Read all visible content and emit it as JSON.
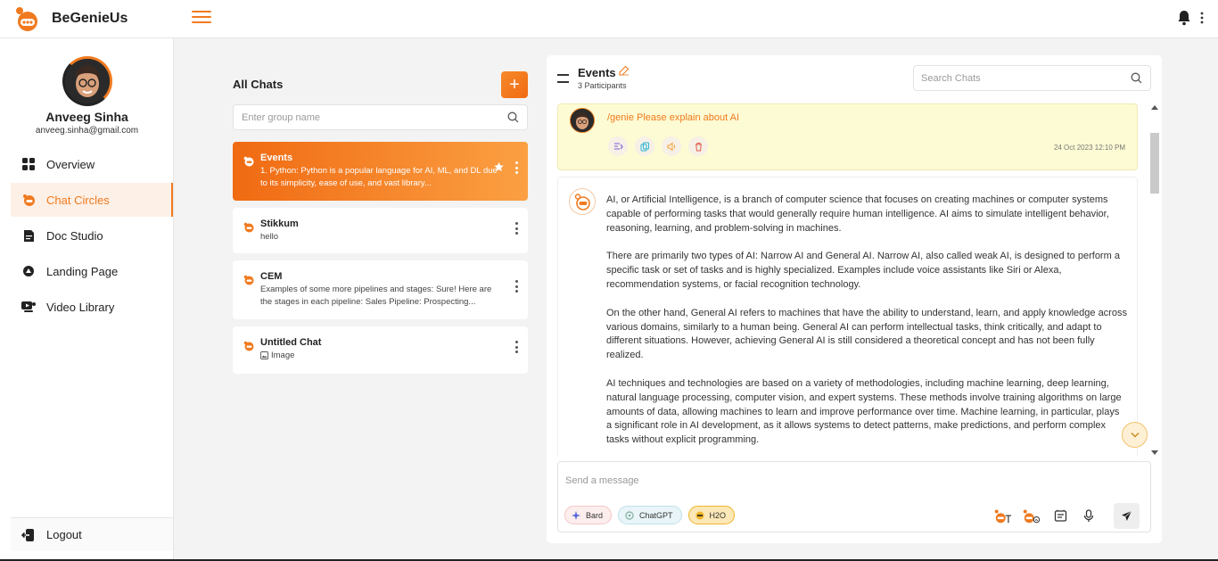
{
  "app": {
    "name": "BeGenieUs"
  },
  "user": {
    "name": "Anveeg Sinha",
    "email": "anveeg.sinha@gmail.com"
  },
  "sidebar": {
    "items": [
      {
        "label": "Overview",
        "icon": "grid-icon",
        "active": false
      },
      {
        "label": "Chat Circles",
        "icon": "chat-circle-icon",
        "active": true
      },
      {
        "label": "Doc Studio",
        "icon": "document-icon",
        "active": false
      },
      {
        "label": "Landing Page",
        "icon": "landing-page-icon",
        "active": false
      },
      {
        "label": "Video Library",
        "icon": "video-library-icon",
        "active": false
      }
    ],
    "logout_label": "Logout"
  },
  "chats": {
    "title": "All Chats",
    "add_label": "+",
    "group_placeholder": "Enter group name",
    "list": [
      {
        "name": "Events",
        "preview": "1. Python: Python is a popular language for AI, ML, and DL due to its simplicity, ease of use, and vast library...",
        "active": true
      },
      {
        "name": "Stikkum",
        "preview": "hello",
        "active": false
      },
      {
        "name": "CEM",
        "preview": "Examples of some more pipelines and stages: Sure! Here are the stages in each pipeline: Sales Pipeline: Prospecting...",
        "active": false
      },
      {
        "name": "Untitled Chat",
        "preview": "Image",
        "active": false
      }
    ]
  },
  "conversation": {
    "title": "Events",
    "participants": "3 Participants",
    "search_placeholder": "Search Chats",
    "user_message": {
      "text": "/genie Please explain about AI",
      "time": "24 Oct 2023 12:10 PM"
    },
    "bot_message": {
      "paragraphs": [
        "AI, or Artificial Intelligence, is a branch of computer science that focuses on creating machines or computer systems capable of performing tasks that would generally require human intelligence. AI aims to simulate intelligent behavior, reasoning, learning, and problem-solving in machines.",
        "There are primarily two types of AI: Narrow AI and General AI. Narrow AI, also called weak AI, is designed to perform a specific task or set of tasks and is highly specialized. Examples include voice assistants like Siri or Alexa, recommendation systems, or facial recognition technology.",
        "On the other hand, General AI refers to machines that have the ability to understand, learn, and apply knowledge across various domains, similarly to a human being. General AI can perform intellectual tasks, think critically, and adapt to different situations. However, achieving General AI is still considered a theoretical concept and has not been fully realized.",
        "AI techniques and technologies are based on a variety of methodologies, including machine learning, deep learning, natural language processing, computer vision, and expert systems. These methods involve training algorithms on large amounts of data, allowing machines to learn and improve performance over time. Machine learning, in particular, plays a significant role in AI development, as it allows systems to detect patterns, make predictions, and perform complex tasks without explicit programming."
      ]
    },
    "composer": {
      "placeholder": "Send a message",
      "models": [
        {
          "label": "Bard",
          "key": "bard"
        },
        {
          "label": "ChatGPT",
          "key": "chatgpt"
        },
        {
          "label": "H2O",
          "key": "h2o"
        }
      ]
    }
  },
  "colors": {
    "accent": "#f07a1f",
    "highlight": "#fdfbd3"
  }
}
